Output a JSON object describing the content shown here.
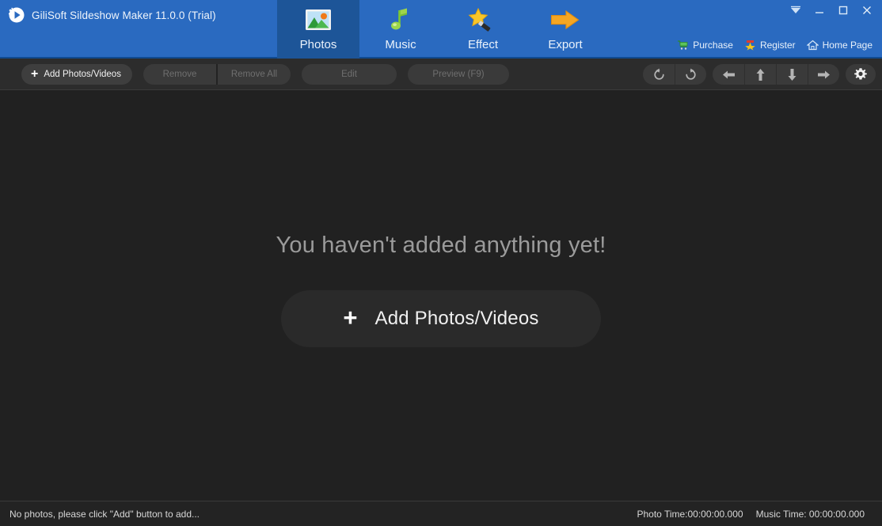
{
  "window": {
    "title": "GiliSoft Sildeshow Maker 11.0.0 (Trial)",
    "logo_icon": "play-sparkle-icon",
    "controls": [
      {
        "name": "skin-menu-button",
        "icon": "chevron-down-icon"
      },
      {
        "name": "minimize-button",
        "icon": "minimize-icon"
      },
      {
        "name": "maximize-button",
        "icon": "maximize-icon"
      },
      {
        "name": "close-button",
        "icon": "close-icon"
      }
    ],
    "accent_blue": "#2a6ac0",
    "accent_blue_active": "#1d5598"
  },
  "nav": {
    "tabs": [
      {
        "label": "Photos",
        "icon": "photo-icon",
        "active": true
      },
      {
        "label": "Music",
        "icon": "music-note-icon",
        "active": false
      },
      {
        "label": "Effect",
        "icon": "magic-wand-icon",
        "active": false
      },
      {
        "label": "Export",
        "icon": "arrow-right-icon",
        "active": false
      }
    ]
  },
  "top_links": [
    {
      "label": "Purchase",
      "icon": "cart-icon"
    },
    {
      "label": "Register",
      "icon": "star-badge-icon"
    },
    {
      "label": "Home Page",
      "icon": "home-icon"
    }
  ],
  "toolbar": {
    "add_label": "Add Photos/Videos",
    "remove_label": "Remove",
    "remove_all_label": "Remove All",
    "edit_label": "Edit",
    "preview_label": "Preview (F9)",
    "right_icons": [
      {
        "name": "rotate-left-icon"
      },
      {
        "name": "rotate-right-icon"
      },
      {
        "name": "move-left-icon"
      },
      {
        "name": "move-up-icon"
      },
      {
        "name": "move-down-icon"
      },
      {
        "name": "move-right-icon"
      },
      {
        "name": "settings-gear-icon"
      }
    ]
  },
  "main": {
    "empty_message": "You haven't added anything yet!",
    "add_button_label": "Add Photos/Videos"
  },
  "status": {
    "message": "No photos, please click \"Add\" button to add...",
    "photo_time": "Photo Time:00:00:00.000",
    "music_time": "Music Time:  00:00:00.000"
  },
  "colors": {
    "toolbar_bg": "#2c2c2c",
    "content_bg": "#212121",
    "statusbar_bg": "#232323",
    "disabled_text": "#6f6f6f"
  }
}
